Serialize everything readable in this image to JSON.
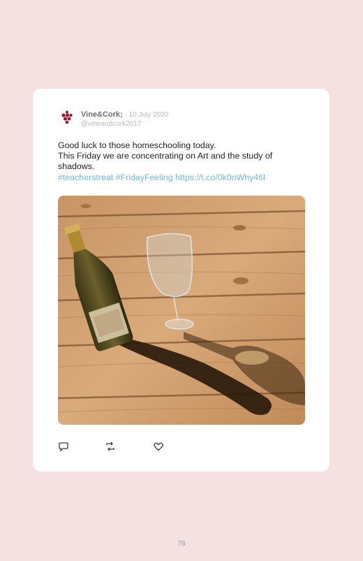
{
  "tweet": {
    "display_name": "Vine&Cork;",
    "date": " · 10 July 2020",
    "handle": "@vineandcork2017",
    "text_line1": "Good luck to those homeschooling today.",
    "text_line2": "This Friday we are concentrating on Art and the study of",
    "text_line3": "shadows.",
    "hashtags": "#teacherstreat #FridayFeeling https://t.co/0k0nWhy46l"
  },
  "icons": {
    "logo": "grape-cluster-icon",
    "reply": "reply-icon",
    "retweet": "retweet-icon",
    "like": "heart-icon"
  },
  "colors": {
    "background": "#f5e1e1",
    "card": "#ffffff",
    "link": "#6fb8e6",
    "logo": "#9b1b30"
  },
  "page": {
    "number": "78"
  }
}
